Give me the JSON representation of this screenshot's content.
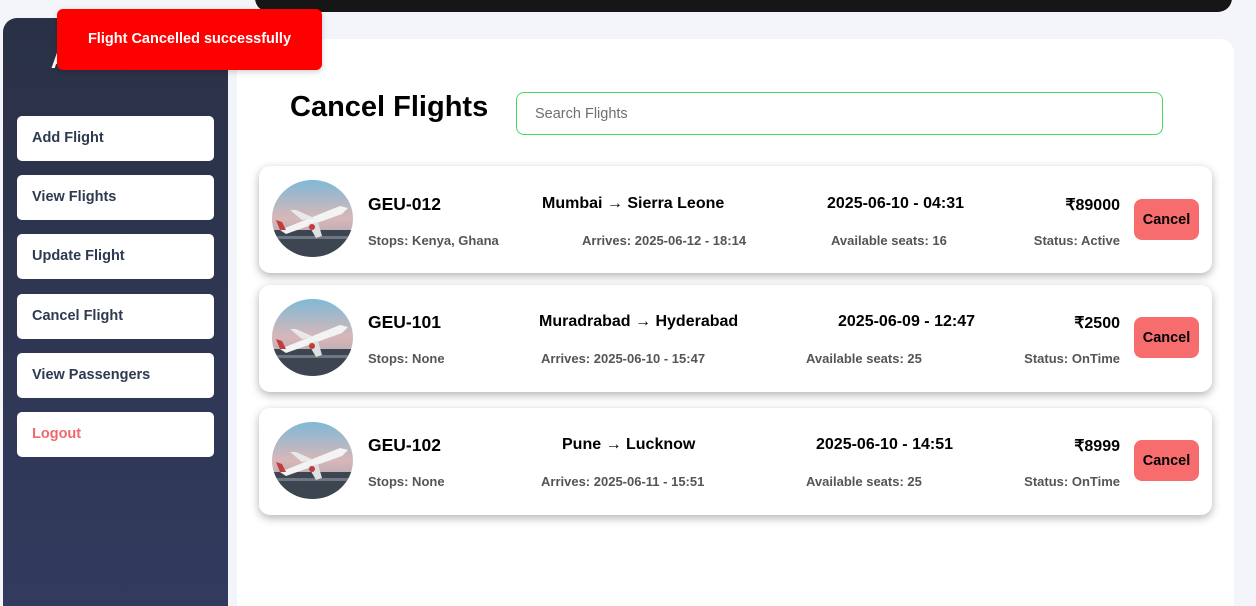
{
  "toast": {
    "message": "Flight Cancelled successfully"
  },
  "sidebar": {
    "title": "A",
    "items": [
      {
        "label": "Add Flight"
      },
      {
        "label": "View Flights"
      },
      {
        "label": "Update Flight"
      },
      {
        "label": "Cancel Flight"
      },
      {
        "label": "View Passengers"
      },
      {
        "label": "Logout"
      }
    ]
  },
  "main": {
    "title": "Cancel Flights",
    "search_placeholder": "Search Flights"
  },
  "flights": [
    {
      "code": "GEU-012",
      "route": "Mumbai → Sierra Leone",
      "departure": "2025-06-10 - 04:31",
      "price": "₹89000",
      "stops": "Stops: Kenya, Ghana",
      "arrives": "Arrives: 2025-06-12 - 18:14",
      "seats": "Available seats: 16",
      "status": "Status: Active",
      "cancel_label": "Cancel"
    },
    {
      "code": "GEU-101",
      "route": "Muradrabad → Hyderabad",
      "departure": "2025-06-09 - 12:47",
      "price": "₹2500",
      "stops": "Stops: None",
      "arrives": "Arrives: 2025-06-10 - 15:47",
      "seats": "Available seats: 25",
      "status": "Status: OnTime",
      "cancel_label": "Cancel"
    },
    {
      "code": "GEU-102",
      "route": "Pune → Lucknow",
      "departure": "2025-06-10 - 14:51",
      "price": "₹8999",
      "stops": "Stops: None",
      "arrives": "Arrives: 2025-06-11 - 15:51",
      "seats": "Available seats: 25",
      "status": "Status: OnTime",
      "cancel_label": "Cancel"
    }
  ],
  "colors": {
    "toast": "#ff0000",
    "cancel": "#f76d6e",
    "logout": "#f0686b",
    "search_border": "#4ad862",
    "sidebar": "#2e3550"
  }
}
